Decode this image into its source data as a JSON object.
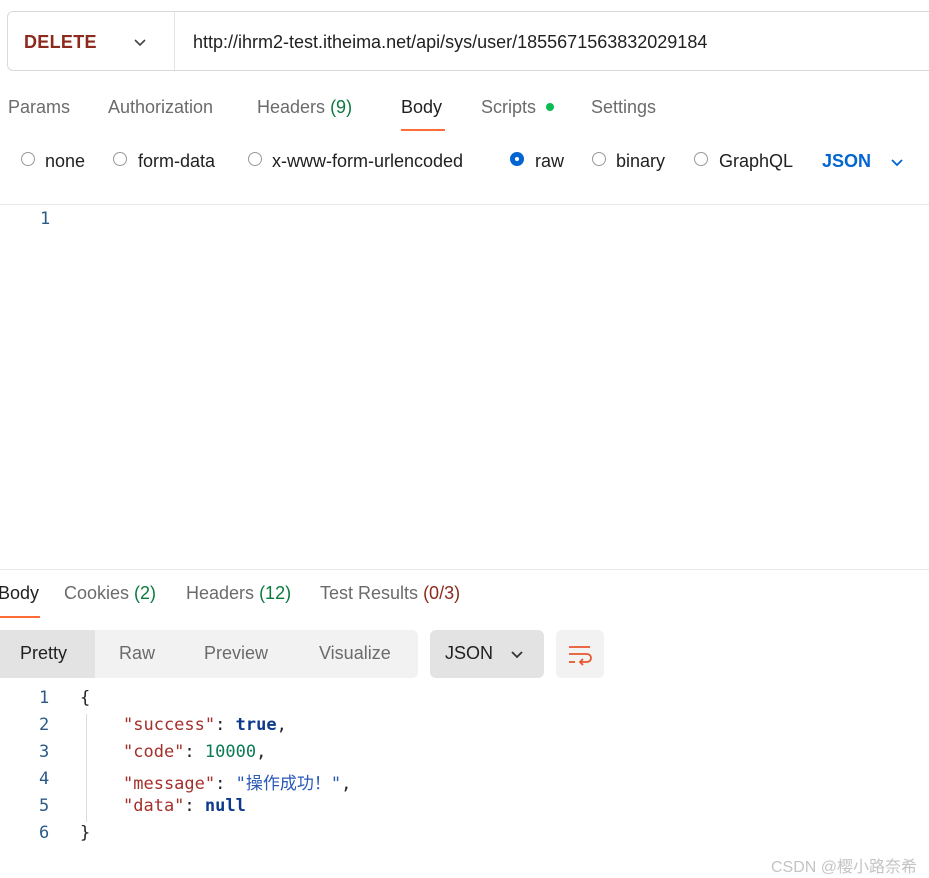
{
  "request": {
    "method": "DELETE",
    "url": "http://ihrm2-test.itheima.net/api/sys/user/1855671563832029184"
  },
  "request_tabs": {
    "params": "Params",
    "authorization": "Authorization",
    "headers": "Headers",
    "headers_count": "(9)",
    "body": "Body",
    "scripts": "Scripts",
    "settings": "Settings",
    "active": "Body"
  },
  "body_types": {
    "none": "none",
    "form_data": "form-data",
    "urlencoded": "x-www-form-urlencoded",
    "raw": "raw",
    "binary": "binary",
    "graphql": "GraphQL",
    "selected": "raw",
    "format": "JSON"
  },
  "editor": {
    "line1": "1"
  },
  "response_tabs": {
    "body": "Body",
    "cookies": "Cookies",
    "cookies_count": "(2)",
    "headers": "Headers",
    "headers_count": "(12)",
    "tests": "Test Results",
    "tests_count": "(0/3)"
  },
  "response_view": {
    "pretty": "Pretty",
    "raw": "Raw",
    "preview": "Preview",
    "visualize": "Visualize",
    "format": "JSON"
  },
  "response_body": {
    "lines": [
      "1",
      "2",
      "3",
      "4",
      "5",
      "6"
    ],
    "open_brace": "{",
    "close_brace": "}",
    "success_key": "\"success\"",
    "success_val": "true",
    "code_key": "\"code\"",
    "code_val": "10000",
    "message_key": "\"message\"",
    "message_val": "\"操作成功！\"",
    "data_key": "\"data\"",
    "data_val": "null",
    "colon": ": ",
    "comma": ","
  },
  "watermark": "CSDN @樱小路奈希",
  "colors": {
    "accent_orange": "#ff6c37",
    "method_red": "#8b2a1d",
    "link_blue": "#0265d2",
    "status_green": "#0cbb52"
  }
}
